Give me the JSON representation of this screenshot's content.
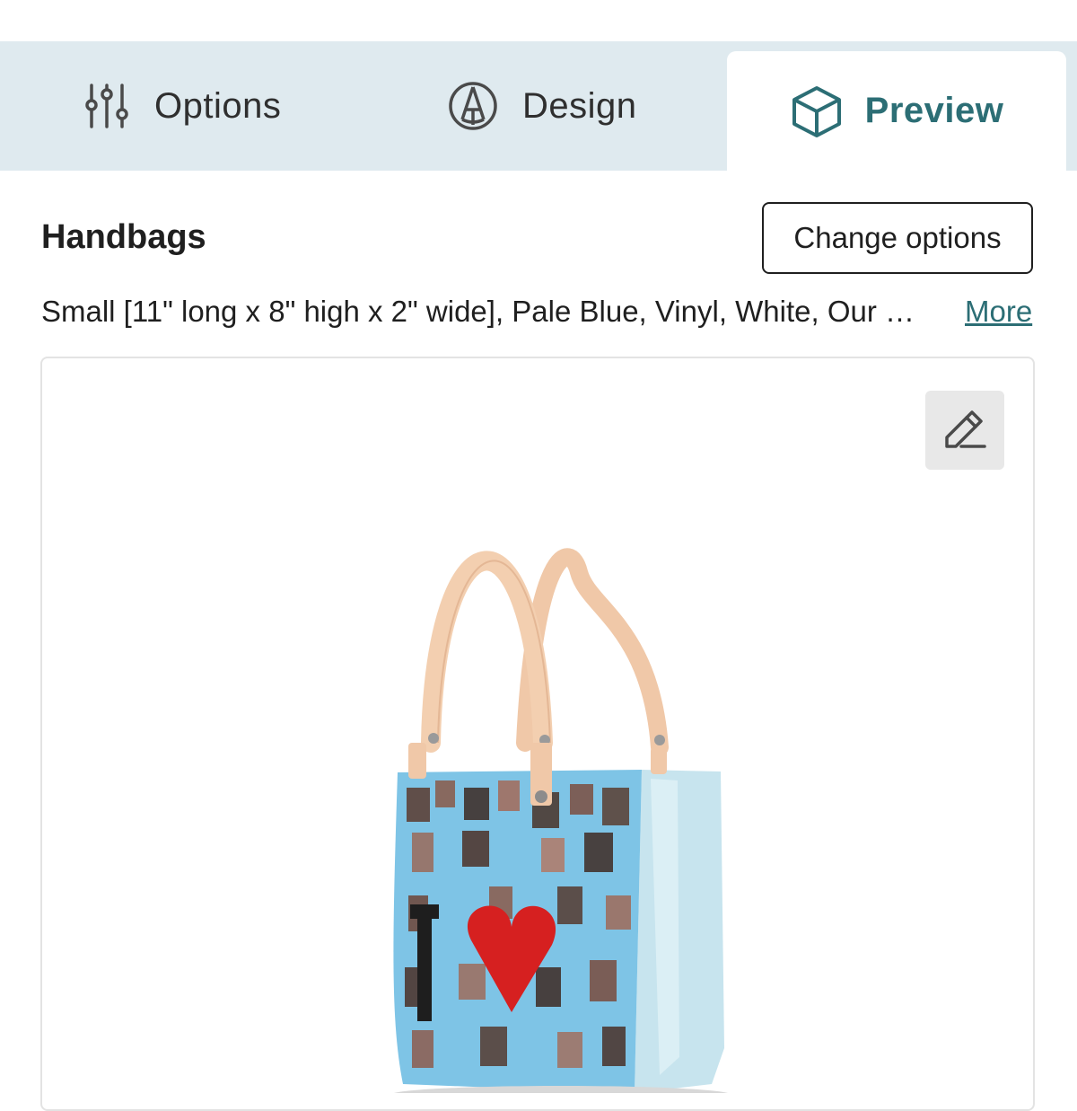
{
  "tabs": [
    {
      "label": "Options",
      "icon": "sliders-icon"
    },
    {
      "label": "Design",
      "icon": "pencil-circle-icon"
    },
    {
      "label": "Preview",
      "icon": "cube-icon",
      "active": true
    }
  ],
  "product": {
    "title": "Handbags",
    "summary": "Small [11\" long x 8\" high x 2\" wide], Pale Blue, Vinyl, White, Our …",
    "more_label": "More",
    "change_options_label": "Change options"
  },
  "preview": {
    "edit_icon": "edit-icon",
    "image": "handbag-3d-preview"
  },
  "colors": {
    "accent": "#2c6e75",
    "tabbar_bg": "#dfeaef",
    "bag_body": "#7ec4e6",
    "bag_side": "#c7e4ee",
    "handles": "#f0c8a8",
    "heart": "#d62020"
  }
}
